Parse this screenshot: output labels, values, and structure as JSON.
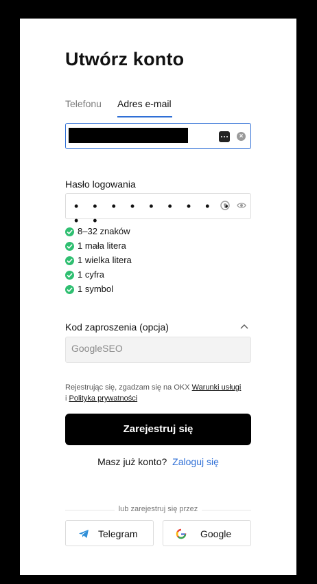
{
  "page": {
    "title": "Utwórz konto"
  },
  "tabs": [
    {
      "label": "Telefonu",
      "active": false
    },
    {
      "label": "Adres e-mail",
      "active": true
    }
  ],
  "email": {
    "value": ""
  },
  "password": {
    "label": "Hasło logowania",
    "masked_value": "• • • • • • • • • • •",
    "rules": [
      {
        "text": "8–32 znaków",
        "ok": true
      },
      {
        "text": "1 mała litera",
        "ok": true
      },
      {
        "text": "1 wielka litera",
        "ok": true
      },
      {
        "text": "1 cyfra",
        "ok": true
      },
      {
        "text": "1 symbol",
        "ok": true
      }
    ]
  },
  "invite": {
    "label": "Kod zaproszenia (opcja)",
    "value": "GoogleSEO"
  },
  "terms": {
    "prefix": "Rejestrując się, zgadzam się na OKX ",
    "link1": "Warunki usługi",
    "separator": " i ",
    "link2": "Polityka prywatności"
  },
  "register_button": "Zarejestruj się",
  "login": {
    "prompt": "Masz już konto?",
    "link": "Zaloguj się"
  },
  "social": {
    "divider": "lub zarejestruj się przez",
    "telegram": "Telegram",
    "google": "Google"
  },
  "colors": {
    "accent": "#2f6fd6",
    "success": "#2fbf71",
    "button": "#000000"
  }
}
